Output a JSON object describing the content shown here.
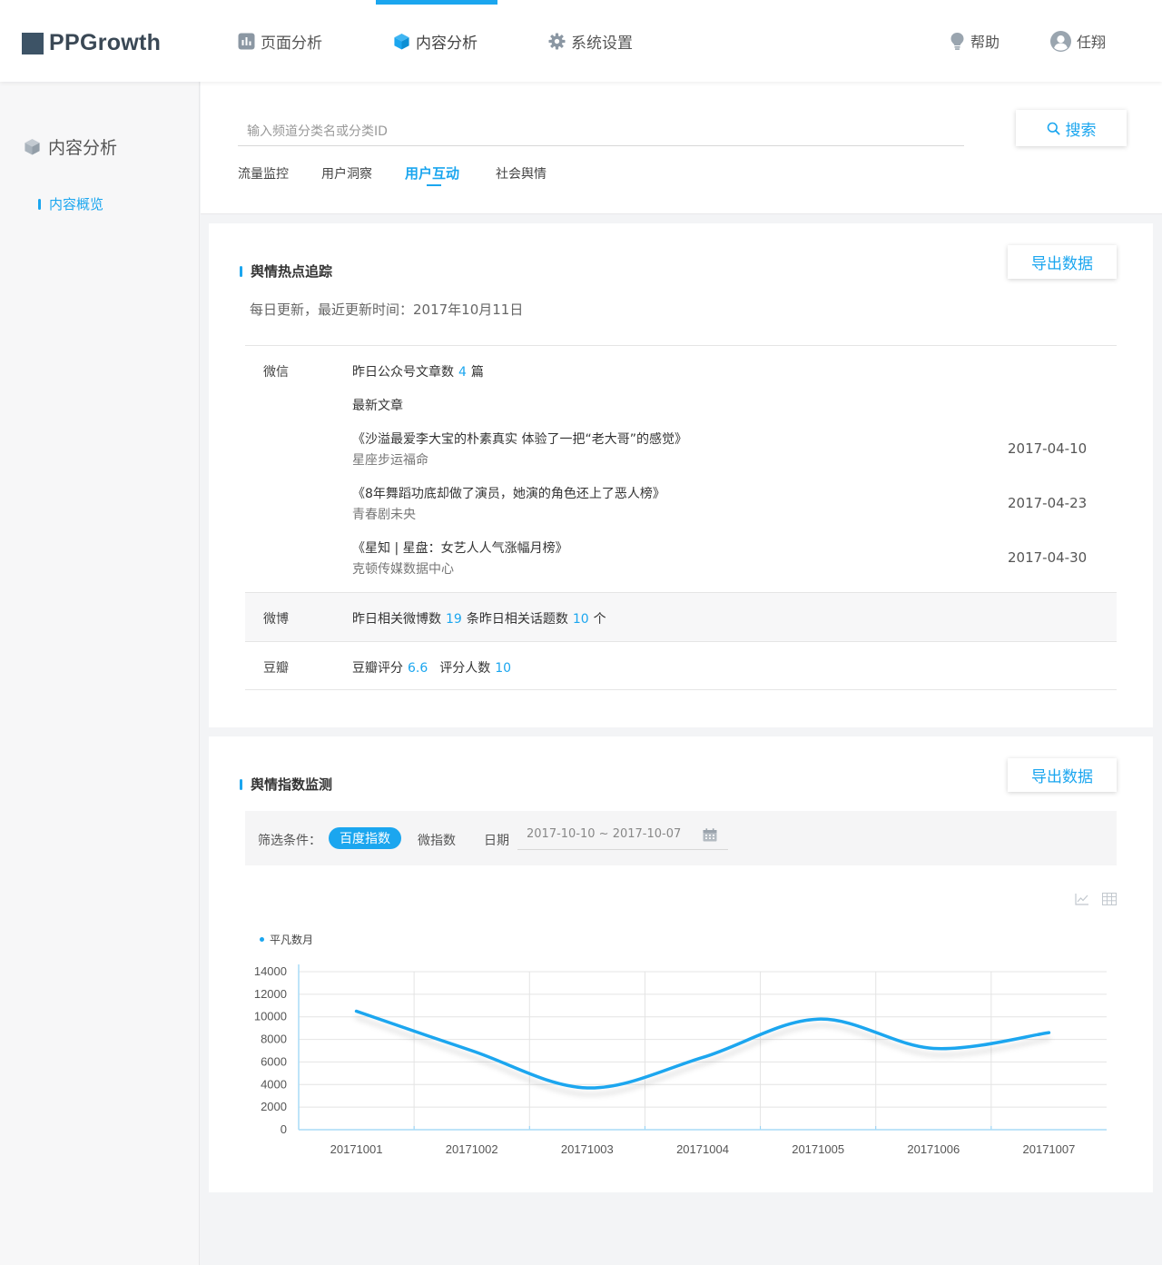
{
  "app": {
    "name": "PPGrowth"
  },
  "nav": {
    "items": [
      {
        "label": "页面分析",
        "icon": "bar-chart-icon"
      },
      {
        "label": "内容分析",
        "icon": "cube-icon"
      },
      {
        "label": "系统设置",
        "icon": "gear-icon"
      }
    ],
    "help": "帮助",
    "user": "任翔"
  },
  "sidebar": {
    "title": "内容分析",
    "items": [
      {
        "label": "内容概览"
      }
    ]
  },
  "search": {
    "placeholder": "输入频道分类名或分类ID",
    "button": "搜索"
  },
  "tabs": [
    "流量监控",
    "用户洞察",
    "用户互动",
    "社会舆情"
  ],
  "hotspot": {
    "title": "舆情热点追踪",
    "export": "导出数据",
    "update": "每日更新，最近更新时间：2017年10月11日",
    "wechat": {
      "label": "微信",
      "count_prefix": "昨日公众号文章数",
      "count": "4",
      "count_suffix": "篇",
      "latest": "最新文章",
      "articles": [
        {
          "title": "《沙溢最爱李大宝的朴素真实 体验了一把“老大哥”的感觉》",
          "source": "星座步运福命",
          "date": "2017-04-10"
        },
        {
          "title": "《8年舞蹈功底却做了演员，她演的角色还上了恶人榜》",
          "source": "青春剧未央",
          "date": "2017-04-23"
        },
        {
          "title": "《星知 | 星盘：女艺人人气涨幅月榜》",
          "source": "克顿传媒数据中心",
          "date": "2017-04-30"
        }
      ]
    },
    "weibo": {
      "label": "微博",
      "posts_prefix": "昨日相关微博数",
      "posts": "19",
      "topics_prefix": "条昨日相关话题数",
      "topics": "10",
      "topics_suffix": "个"
    },
    "douban": {
      "label": "豆瓣",
      "rating_prefix": "豆瓣评分",
      "rating": "6.6",
      "raters_prefix": "评分人数",
      "raters": "10"
    }
  },
  "monitor": {
    "title": "舆情指数监测",
    "export": "导出数据",
    "filter_label": "筛选条件：",
    "filters": [
      "百度指数",
      "微指数"
    ],
    "date_label": "日期",
    "date_range": "2017-10-10 ~ 2017-10-07"
  },
  "chart_data": {
    "type": "line",
    "categories": [
      "20171001",
      "20171002",
      "20171003",
      "20171004",
      "20171005",
      "20171006",
      "20171007"
    ],
    "series": [
      {
        "name": "平凡数月",
        "values": [
          10500,
          7000,
          3700,
          6400,
          9800,
          7200,
          8600
        ],
        "color": "#1ba6ef"
      }
    ],
    "yticks": [
      0,
      2000,
      4000,
      6000,
      8000,
      10000,
      12000,
      14000
    ],
    "ylim": [
      0,
      14000
    ],
    "grid": true,
    "legend": "top-left",
    "title": "",
    "xlabel": "",
    "ylabel": ""
  }
}
